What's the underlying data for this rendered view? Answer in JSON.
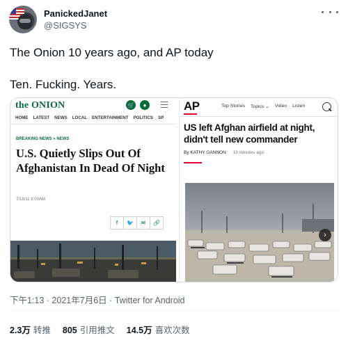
{
  "author": {
    "display_name": "PanickedJanet",
    "handle": "@SIGSYS"
  },
  "tweet": {
    "line1": "The Onion 10 years ago, and AP today",
    "line2": "Ten. Fucking. Years."
  },
  "onion": {
    "logo": "the ONION",
    "nav": [
      "HOME",
      "LATEST",
      "NEWS",
      "LOCAL",
      "ENTERTAINMENT",
      "POLITICS",
      "SP"
    ],
    "category_breaking": "BREAKING NEWS",
    "category_separator": "»",
    "category_news": "NEWS",
    "headline": "U.S. Quietly Slips Out Of Afghanistan In Dead Of Night",
    "date": "7/18/11 8:00AM",
    "brand_color": "#0a6b3a"
  },
  "ap": {
    "logo": "AP",
    "nav": [
      "Top Stories",
      "Topics ⌄",
      "Video",
      "Listen"
    ],
    "headline": "US left Afghan airfield at night, didn't tell new commander",
    "byline_author": "By KATHY GANNON",
    "byline_time": "19 minutes ago",
    "accent_color": "#e4002b"
  },
  "meta": {
    "time": "下午1:13 · 2021年7月6日 · Twitter for Android"
  },
  "stats": {
    "retweets_value": "2.3万",
    "retweets_label": "转推",
    "quotes_value": "805",
    "quotes_label": "引用推文",
    "likes_value": "14.5万",
    "likes_label": "喜欢次数"
  }
}
